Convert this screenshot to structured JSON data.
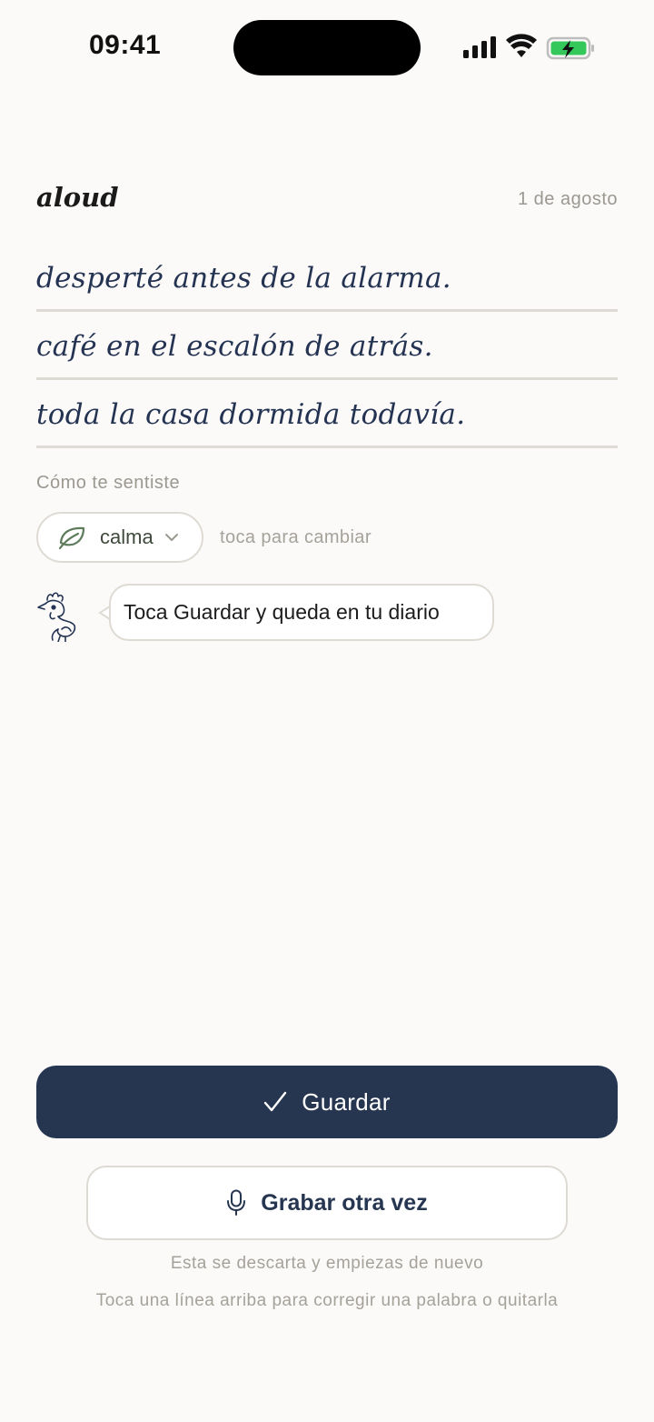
{
  "status_bar": {
    "time": "09:41",
    "icons": [
      "signal-icon",
      "wifi-icon",
      "battery-charging-icon"
    ]
  },
  "header": {
    "app_title": "aloud",
    "date": "1 de agosto"
  },
  "transcript": {
    "lines": [
      "desperté antes de la alarma.",
      "café en el escalón de atrás.",
      "toda la casa dormida todavía."
    ]
  },
  "mood": {
    "label": "Cómo te sentiste",
    "selected": "calma",
    "icon": "leaf-icon",
    "hint": "toca para cambiar"
  },
  "tip": {
    "text": "Toca Guardar y queda en tu diario"
  },
  "actions": {
    "save_label": "Guardar",
    "record_label": "Grabar otra vez",
    "record_note": "Esta se descarta y empiezas de nuevo",
    "edit_hint": "Toca una línea arriba para corregir una palabra o quitarla"
  },
  "colors": {
    "background": "#fbfaf8",
    "primary": "#263651",
    "line_text": "#243352",
    "muted": "#9b9890",
    "border": "#dedbd4",
    "battery": "#34c759"
  }
}
